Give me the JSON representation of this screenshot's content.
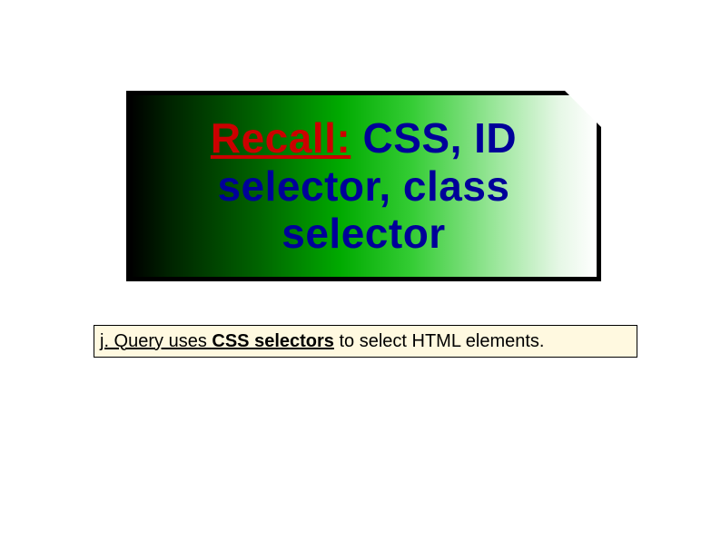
{
  "title": {
    "recall": "Recall:",
    "rest_line1": " CSS, ID",
    "line2": "selector, class",
    "line3": "selector"
  },
  "note": {
    "part1": "j. Query uses ",
    "part2": "CSS selectors",
    "part3": " to select HTML elements."
  }
}
